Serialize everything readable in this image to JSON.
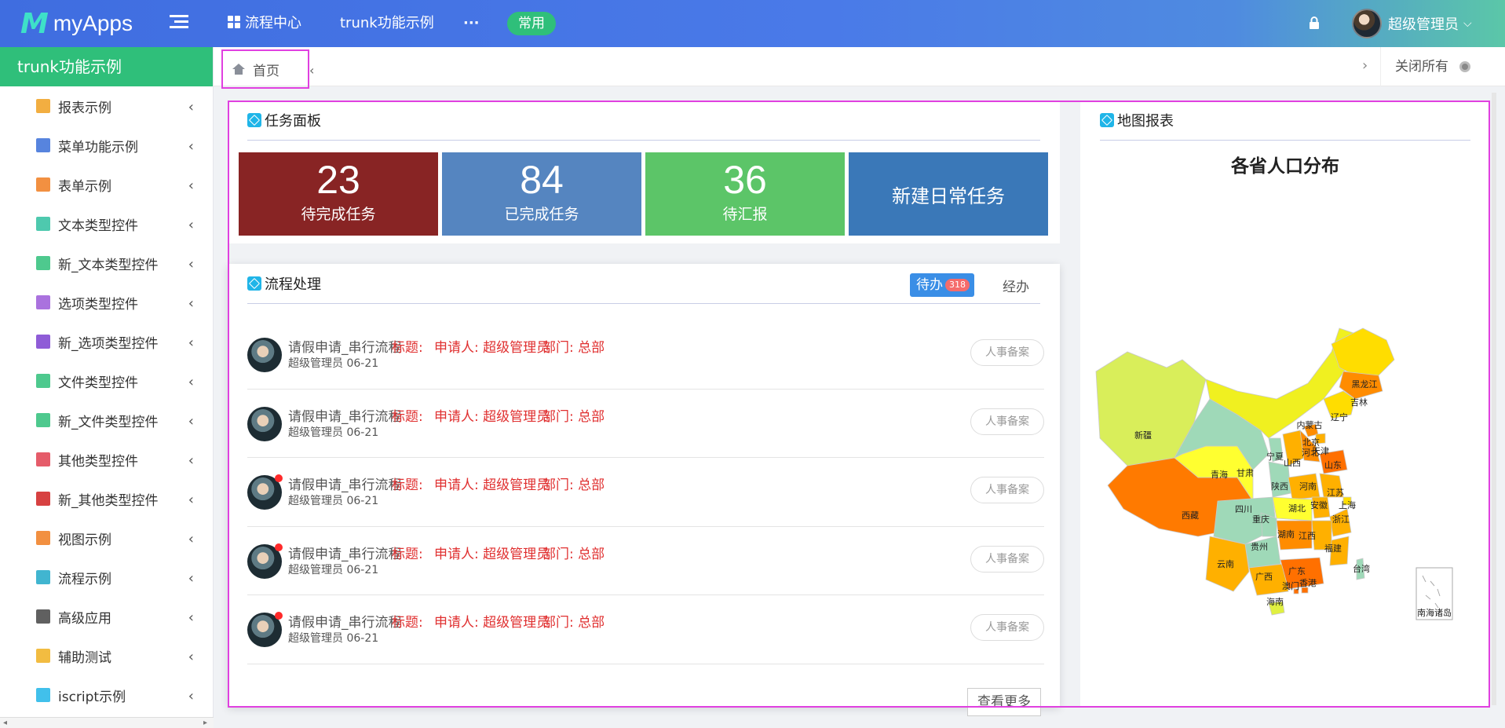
{
  "header": {
    "logo_mark": "M",
    "app_name": "myApps",
    "nav": {
      "flow_center": "流程中心",
      "trunk_demo": "trunk功能示例",
      "more": "···"
    },
    "common_badge": "常用",
    "user_name": "超级管理员",
    "caret": "⌵"
  },
  "sidebar": {
    "title": "trunk功能示例",
    "arrow": "‹",
    "items": [
      {
        "label": "报表示例",
        "icon": "area-chart-icon",
        "color": "#f0a020"
      },
      {
        "label": "菜单功能示例",
        "icon": "list-icon",
        "color": "#3a6fd8"
      },
      {
        "label": "表单示例",
        "icon": "table-icon",
        "color": "#f07d20"
      },
      {
        "label": "文本类型控件",
        "icon": "file-text-icon",
        "color": "#2fbfa0"
      },
      {
        "label": "新_文本类型控件",
        "icon": "file-text-filled-icon",
        "color": "#2fbf7a"
      },
      {
        "label": "选项类型控件",
        "icon": "checkbox-icon",
        "color": "#9b59d8"
      },
      {
        "label": "新_选项类型控件",
        "icon": "checkbox-filled-icon",
        "color": "#7b3fd0"
      },
      {
        "label": "文件类型控件",
        "icon": "folder-open-icon",
        "color": "#2fbf7a"
      },
      {
        "label": "新_文件类型控件",
        "icon": "folder-open-filled-icon",
        "color": "#2fbf7a"
      },
      {
        "label": "其他类型控件",
        "icon": "cube-icon",
        "color": "#e04050"
      },
      {
        "label": "新_其他类型控件",
        "icon": "cubes-icon",
        "color": "#d02020"
      },
      {
        "label": "视图示例",
        "icon": "columns-icon",
        "color": "#f07d20"
      },
      {
        "label": "流程示例",
        "icon": "shuffle-icon",
        "color": "#20a8c8"
      },
      {
        "label": "高级应用",
        "icon": "server-icon",
        "color": "#444444"
      },
      {
        "label": "辅助测试",
        "icon": "gavel-icon",
        "color": "#f0b020"
      },
      {
        "label": "iscript示例",
        "icon": "cube-blue-icon",
        "color": "#20b5e8"
      }
    ]
  },
  "tabbar": {
    "home": "首页",
    "left_arrow": "‹",
    "right_arrow": "›",
    "close_all": "关闭所有"
  },
  "task_panel": {
    "title": "任务面板",
    "stats": [
      {
        "value": "23",
        "label": "待完成任务",
        "color": "#882424"
      },
      {
        "value": "84",
        "label": "已完成任务",
        "color": "#5585c0"
      },
      {
        "value": "36",
        "label": "待汇报",
        "color": "#5cc568"
      }
    ],
    "new_task": {
      "label": "新建日常任务",
      "color": "#3a78b8"
    }
  },
  "flow_panel": {
    "title": "流程处理",
    "tab_todo": "待办",
    "todo_count": "318",
    "tab_done": "经办",
    "more": "查看更多",
    "rows": [
      {
        "title": "请假申请_串行流程",
        "sub": "超级管理员 06-21",
        "label_title": "标题:",
        "applicant": "申请人: 超级管理员",
        "dept": "部门: 总部",
        "tag": "人事备案",
        "unread": false
      },
      {
        "title": "请假申请_串行流程",
        "sub": "超级管理员 06-21",
        "label_title": "标题:",
        "applicant": "申请人: 超级管理员",
        "dept": "部门: 总部",
        "tag": "人事备案",
        "unread": false
      },
      {
        "title": "请假申请_串行流程",
        "sub": "超级管理员 06-21",
        "label_title": "标题:",
        "applicant": "申请人: 超级管理员",
        "dept": "部门: 总部",
        "tag": "人事备案",
        "unread": true
      },
      {
        "title": "请假申请_串行流程",
        "sub": "超级管理员 06-21",
        "label_title": "标题:",
        "applicant": "申请人: 超级管理员",
        "dept": "部门: 总部",
        "tag": "人事备案",
        "unread": true
      },
      {
        "title": "请假申请_串行流程",
        "sub": "超级管理员 06-21",
        "label_title": "标题:",
        "applicant": "申请人: 超级管理员",
        "dept": "部门: 总部",
        "tag": "人事备案",
        "unread": true
      }
    ]
  },
  "map_panel": {
    "title": "地图报表",
    "chart_title": "各省人口分布",
    "south_sea_label": "南海诸岛",
    "provinces": [
      {
        "name": "黑龙江",
        "color": "#ffdd00"
      },
      {
        "name": "吉林",
        "color": "#ff8c00"
      },
      {
        "name": "辽宁",
        "color": "#ffdd00"
      },
      {
        "name": "内蒙古",
        "color": "#f0f020"
      },
      {
        "name": "北京",
        "color": "#ff8c00"
      },
      {
        "name": "天津",
        "color": "#ffb000"
      },
      {
        "name": "河北",
        "color": "#ff8c00"
      },
      {
        "name": "山东",
        "color": "#ff7000"
      },
      {
        "name": "新疆",
        "color": "#d9ee5a"
      },
      {
        "name": "宁夏",
        "color": "#9fd9b8"
      },
      {
        "name": "甘肃",
        "color": "#9fd9b8"
      },
      {
        "name": "山西",
        "color": "#ffb000"
      },
      {
        "name": "青海",
        "color": "#ffff30"
      },
      {
        "name": "陕西",
        "color": "#9fd9b8"
      },
      {
        "name": "河南",
        "color": "#ffb000"
      },
      {
        "name": "江苏",
        "color": "#ffb000"
      },
      {
        "name": "西藏",
        "color": "#ff7a00"
      },
      {
        "name": "四川",
        "color": "#9fd9b8"
      },
      {
        "name": "湖北",
        "color": "#ffff30"
      },
      {
        "name": "安徽",
        "color": "#ffb000"
      },
      {
        "name": "上海",
        "color": "#ffdd00"
      },
      {
        "name": "重庆",
        "color": "#9fd9b8"
      },
      {
        "name": "浙江",
        "color": "#ffb000"
      },
      {
        "name": "湖南",
        "color": "#ff8c00"
      },
      {
        "name": "江西",
        "color": "#ffb000"
      },
      {
        "name": "贵州",
        "color": "#9fd9b8"
      },
      {
        "name": "福建",
        "color": "#ffb000"
      },
      {
        "name": "云南",
        "color": "#ffb000"
      },
      {
        "name": "广西",
        "color": "#ffb000"
      },
      {
        "name": "广东",
        "color": "#ff7000"
      },
      {
        "name": "台湾",
        "color": "#9fd9b8"
      },
      {
        "name": "香港",
        "color": "#ff7000"
      },
      {
        "name": "澳门",
        "color": "#ff7000"
      },
      {
        "name": "海南",
        "color": "#e0f040"
      }
    ]
  }
}
